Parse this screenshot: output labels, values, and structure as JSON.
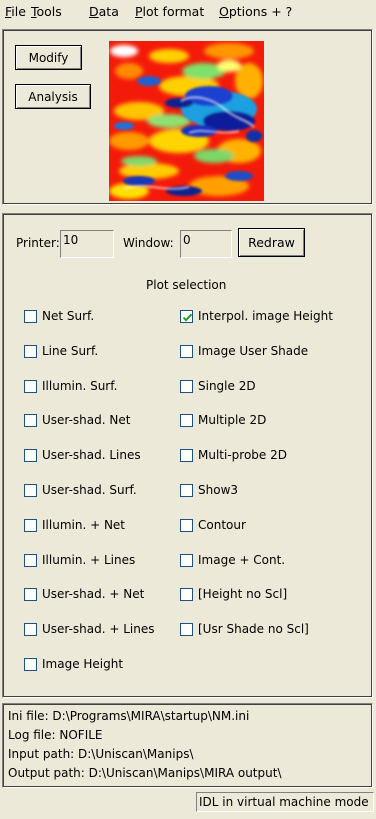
{
  "menu": [
    {
      "label": "File",
      "underline_index": 0
    },
    {
      "label": "Tools",
      "underline_index": 0
    },
    {
      "label": "Data",
      "underline_index": 0
    },
    {
      "label": "Plot format",
      "underline_index": 0
    },
    {
      "label": "Options + ?",
      "underline_index": 0
    }
  ],
  "top": {
    "modify_label": "Modify",
    "analysis_label": "Analysis"
  },
  "controls": {
    "printer_label": "Printer:",
    "printer_value": "10",
    "window_label": "Window:",
    "window_value": "0",
    "redraw_label": "Redraw",
    "plot_selection_title": "Plot selection"
  },
  "plot_options_left": [
    {
      "label": "Net Surf.",
      "checked": false
    },
    {
      "label": "Line Surf.",
      "checked": false
    },
    {
      "label": "Illumin. Surf.",
      "checked": false
    },
    {
      "label": "User-shad. Net",
      "checked": false
    },
    {
      "label": "User-shad. Lines",
      "checked": false
    },
    {
      "label": "User-shad. Surf.",
      "checked": false
    },
    {
      "label": "Illumin. + Net",
      "checked": false
    },
    {
      "label": "Illumin. + Lines",
      "checked": false
    },
    {
      "label": "User-shad. + Net",
      "checked": false
    },
    {
      "label": "User-shad. + Lines",
      "checked": false
    },
    {
      "label": "Image Height",
      "checked": false
    }
  ],
  "plot_options_right": [
    {
      "label": "Interpol. image Height",
      "checked": true
    },
    {
      "label": "Image User Shade",
      "checked": false
    },
    {
      "label": "Single 2D",
      "checked": false
    },
    {
      "label": "Multiple 2D",
      "checked": false
    },
    {
      "label": "Multi-probe 2D",
      "checked": false
    },
    {
      "label": "Show3",
      "checked": false
    },
    {
      "label": "Contour",
      "checked": false
    },
    {
      "label": "Image + Cont.",
      "checked": false
    },
    {
      "label": "[Height no Scl]",
      "checked": false
    },
    {
      "label": "[Usr Shade no Scl]",
      "checked": false
    }
  ],
  "info": {
    "ini_file": "Ini file: D:\\Programs\\MIRA\\startup\\NM.ini",
    "log_file": "Log file: NOFILE",
    "input_path": "Input path: D:\\Uniscan\\Manips\\",
    "output_path": "Output path: D:\\Uniscan\\Manips\\MIRA output\\"
  },
  "status": "IDL in virtual machine mode",
  "colors": {
    "background": "#ece9d8",
    "checkbox_border": "#1c5180",
    "check_mark": "#21a121"
  }
}
